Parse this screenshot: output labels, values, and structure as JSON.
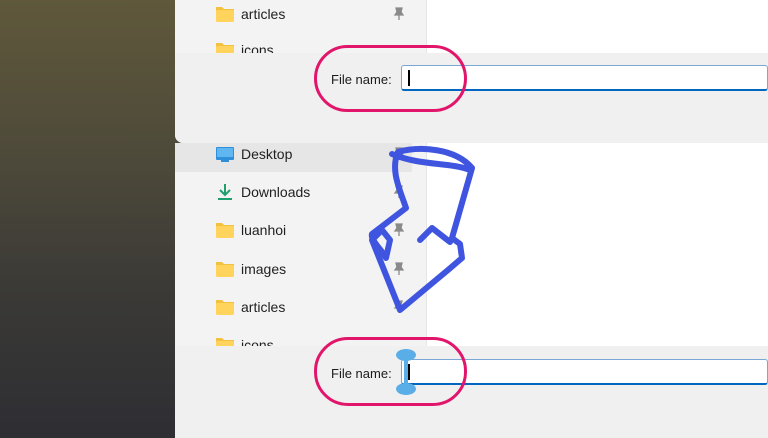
{
  "top_dialog": {
    "nav_items": [
      {
        "label": "articles",
        "icon": "folder-icon",
        "pinned": true
      },
      {
        "label": "icons",
        "icon": "folder-icon",
        "pinned": false
      }
    ],
    "file_name_label": "File name:",
    "file_name_value": ""
  },
  "bottom_dialog": {
    "nav_items": [
      {
        "label": "Desktop",
        "icon": "desktop-icon",
        "pinned": true,
        "selected": true
      },
      {
        "label": "Downloads",
        "icon": "download-icon",
        "pinned": true
      },
      {
        "label": "luanhoi",
        "icon": "folder-icon",
        "pinned": true
      },
      {
        "label": "images",
        "icon": "folder-icon",
        "pinned": true
      },
      {
        "label": "articles",
        "icon": "folder-icon",
        "pinned": true
      },
      {
        "label": "icons",
        "icon": "folder-icon",
        "pinned": false
      }
    ],
    "file_name_label": "File name:",
    "file_name_value": ""
  },
  "annotations": {
    "highlight_color": "#e1166b",
    "arrow_color": "#3f55e0",
    "handle_color": "#5aaee8"
  }
}
